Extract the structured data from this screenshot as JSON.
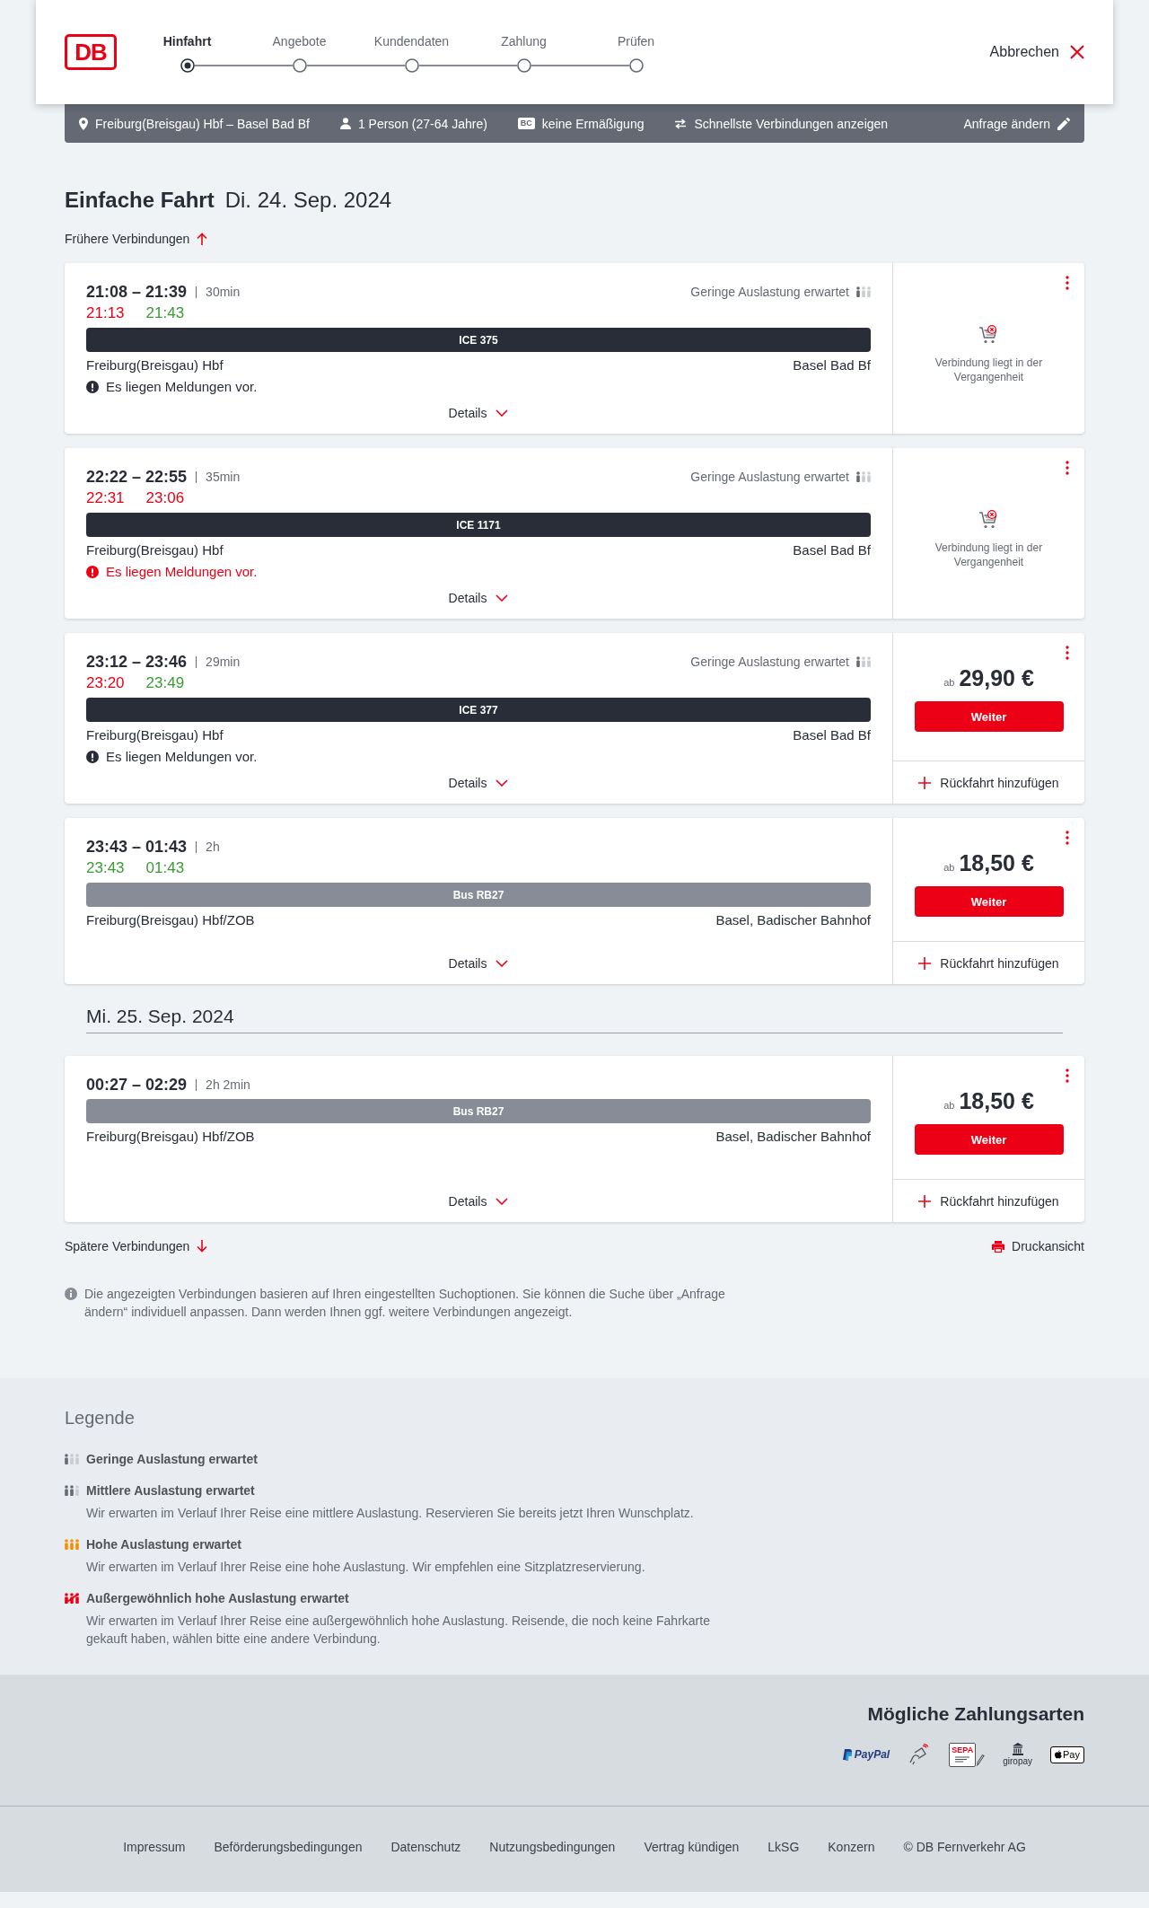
{
  "header": {
    "logo": "DB",
    "steps": [
      {
        "label": "Hinfahrt",
        "selected": true
      },
      {
        "label": "Angebote",
        "selected": false
      },
      {
        "label": "Kundendaten",
        "selected": false
      },
      {
        "label": "Zahlung",
        "selected": false
      },
      {
        "label": "Prüfen",
        "selected": false
      }
    ],
    "cancel": "Abbrechen"
  },
  "search_summary": {
    "route": "Freiburg(Breisgau) Hbf – Basel Bad Bf",
    "passengers": "1 Person (27-64 Jahre)",
    "card_badge": "BC",
    "discount": "keine Ermäßigung",
    "option": "Schnellste Verbindungen anzeigen",
    "edit": "Anfrage ändern"
  },
  "title": "Einfache Fahrt",
  "date": "Di. 24. Sep. 2024",
  "earlier": "Frühere Verbindungen",
  "days": [
    {
      "connections": [
        {
          "times": "21:08 – 21:39",
          "duration": "30min",
          "realtime": [
            {
              "time": "21:13",
              "delayed": true
            },
            {
              "time": "21:43",
              "delayed": false
            }
          ],
          "occupancy": {
            "kind": "low",
            "text": "Geringe Auslastung erwartet"
          },
          "product": {
            "kind": "train",
            "label": "ICE 375"
          },
          "from": "Freiburg(Breisgau) Hbf",
          "to": "Basel Bad Bf",
          "message": {
            "text": "Es liegen Meldungen vor.",
            "alert": false
          },
          "details": "Details",
          "offer": {
            "kind": "past",
            "text": "Verbindung liegt in der Vergangenheit"
          }
        },
        {
          "times": "22:22 – 22:55",
          "duration": "35min",
          "realtime": [
            {
              "time": "22:31",
              "delayed": true
            },
            {
              "time": "23:06",
              "delayed": true
            }
          ],
          "occupancy": {
            "kind": "low",
            "text": "Geringe Auslastung erwartet"
          },
          "product": {
            "kind": "train",
            "label": "ICE 1171"
          },
          "from": "Freiburg(Breisgau) Hbf",
          "to": "Basel Bad Bf",
          "message": {
            "text": "Es liegen Meldungen vor.",
            "alert": true
          },
          "details": "Details",
          "offer": {
            "kind": "past",
            "text": "Verbindung liegt in der Vergangenheit"
          }
        },
        {
          "times": "23:12 – 23:46",
          "duration": "29min",
          "realtime": [
            {
              "time": "23:20",
              "delayed": true
            },
            {
              "time": "23:49",
              "delayed": false
            }
          ],
          "occupancy": {
            "kind": "low",
            "text": "Geringe Auslastung erwartet"
          },
          "product": {
            "kind": "train",
            "label": "ICE 377"
          },
          "from": "Freiburg(Breisgau) Hbf",
          "to": "Basel Bad Bf",
          "message": {
            "text": "Es liegen Meldungen vor.",
            "alert": false
          },
          "details": "Details",
          "offer": {
            "kind": "price",
            "prefix": "ab",
            "price": "29,90 €",
            "button": "Weiter",
            "return": "Rückfahrt hinzufügen"
          }
        },
        {
          "times": "23:43 – 01:43",
          "duration": "2h",
          "realtime": [
            {
              "time": "23:43",
              "delayed": false
            },
            {
              "time": "01:43",
              "delayed": false
            }
          ],
          "product": {
            "kind": "bus",
            "label": "Bus RB27"
          },
          "from": "Freiburg(Breisgau) Hbf/ZOB",
          "to": "Basel, Badischer Bahnhof",
          "details": "Details",
          "offer": {
            "kind": "price",
            "prefix": "ab",
            "price": "18,50 €",
            "button": "Weiter",
            "return": "Rückfahrt hinzufügen"
          }
        }
      ]
    },
    {
      "date": "Mi. 25. Sep. 2024",
      "connections": [
        {
          "times": "00:27 – 02:29",
          "duration": "2h 2min",
          "product": {
            "kind": "bus",
            "label": "Bus RB27"
          },
          "from": "Freiburg(Breisgau) Hbf/ZOB",
          "to": "Basel, Badischer Bahnhof",
          "details": "Details",
          "offer": {
            "kind": "price",
            "prefix": "ab",
            "price": "18,50 €",
            "button": "Weiter",
            "return": "Rückfahrt hinzufügen"
          }
        }
      ]
    }
  ],
  "later": "Spätere Verbindungen",
  "print": "Druckansicht",
  "note": "Die angezeigten Verbindungen basieren auf Ihren eingestellten Suchoptionen. Sie können die Suche über „Anfrage ändern“ individuell anpassen. Dann werden Ihnen ggf. weitere Verbindungen angezeigt.",
  "legend": {
    "title": "Legende",
    "items": [
      {
        "kind": "low",
        "title": "Geringe Auslastung erwartet"
      },
      {
        "kind": "medium",
        "title": "Mittlere Auslastung erwartet",
        "text": "Wir erwarten im Verlauf Ihrer Reise eine mittlere Auslastung. Reservieren Sie bereits jetzt Ihren Wunschplatz."
      },
      {
        "kind": "high",
        "title": "Hohe Auslastung erwartet",
        "text": "Wir erwarten im Verlauf Ihrer Reise eine hohe Auslastung. Wir empfehlen eine Sitzplatzreservierung."
      },
      {
        "kind": "exceptional",
        "title": "Außergewöhnlich hohe Auslastung erwartet",
        "text": "Wir erwarten im Verlauf Ihrer Reise eine außergewöhnlich hohe Auslastung. Reisende, die noch keine Fahrkarte gekauft haben, wählen bitte eine andere Verbindung."
      }
    ]
  },
  "payment": {
    "title": "Mögliche Zahlungsarten",
    "methods": [
      {
        "kind": "paypal",
        "label": "PayPal"
      },
      {
        "kind": "card"
      },
      {
        "kind": "sepa",
        "label": "SEPA"
      },
      {
        "kind": "giropay",
        "label": "giropay"
      },
      {
        "kind": "applepay",
        "label": "Pay"
      }
    ]
  },
  "footer": {
    "links": [
      "Impressum",
      "Beförderungsbedingungen",
      "Datenschutz",
      "Nutzungsbedingungen",
      "Vertrag kündigen",
      "LkSG",
      "Konzern"
    ],
    "copyright": "© DB Fernverkehr AG"
  }
}
